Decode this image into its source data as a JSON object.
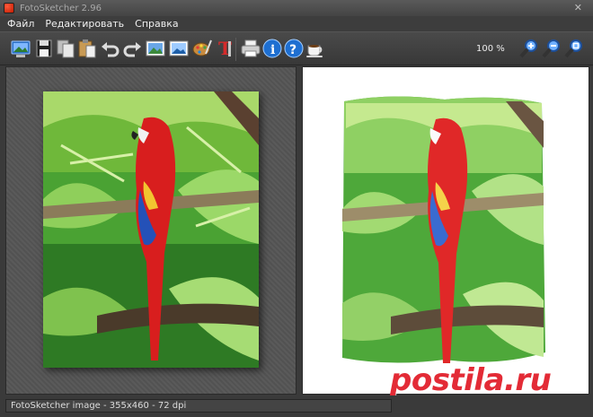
{
  "window": {
    "title": "FotoSketcher 2.96",
    "close_label": "✕"
  },
  "menu": {
    "items": [
      "Файл",
      "Редактировать",
      "Справка"
    ]
  },
  "toolbar": {
    "zoom_level": "100 %",
    "buttons": [
      {
        "name": "open-image-icon"
      },
      {
        "name": "save-icon"
      },
      {
        "name": "copy-icon"
      },
      {
        "name": "paste-icon"
      },
      {
        "name": "undo-icon"
      },
      {
        "name": "redo-icon"
      },
      {
        "name": "original-image-icon"
      },
      {
        "name": "result-image-icon"
      },
      {
        "name": "palette-icon"
      },
      {
        "name": "text-tool-icon"
      },
      {
        "name": "print-icon"
      },
      {
        "name": "info-icon"
      },
      {
        "name": "help-icon"
      },
      {
        "name": "coffee-icon"
      },
      {
        "name": "zoom-in-icon"
      },
      {
        "name": "zoom-out-icon"
      },
      {
        "name": "zoom-fit-icon"
      }
    ]
  },
  "status": {
    "text": "FotoSketcher image - 355x460 - 72 dpi"
  },
  "watermark": {
    "text": "postila.ru"
  },
  "colors": {
    "accent_red": "#e32b36",
    "panel_bg": "#555555",
    "toolbar_bg": "#3d3d3d"
  }
}
